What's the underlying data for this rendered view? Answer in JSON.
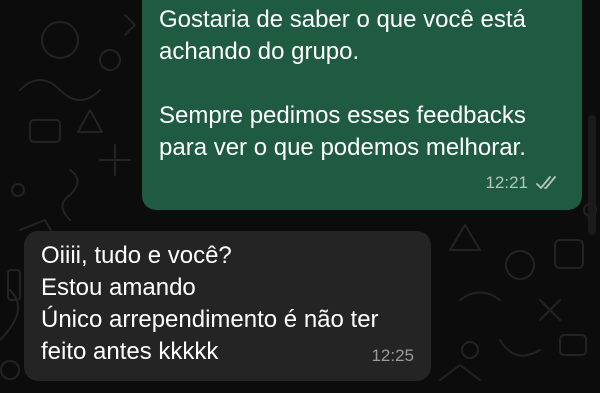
{
  "messages": {
    "outgoing": {
      "lines": [
        "Gostaria de saber o que você está",
        "achando do grupo.",
        "Sempre pedimos esses feedbacks",
        "para ver o que podemos melhorar."
      ],
      "time": "12:21",
      "status_icon": "double-check-icon"
    },
    "incoming": {
      "lines": [
        "Oiiii, tudo e você?",
        "Estou amando",
        "Único arrependimento é não ter",
        "feito antes kkkkk"
      ],
      "time": "12:25"
    }
  },
  "colors": {
    "background": "#0c0c0c",
    "outgoing_bubble": "#1f5b41",
    "incoming_bubble": "#242424",
    "text": "#ffffff",
    "doodle": "#232323"
  }
}
